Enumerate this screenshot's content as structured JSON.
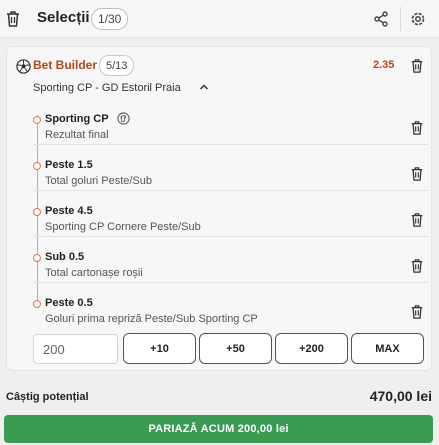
{
  "header": {
    "title": "Selecții",
    "count": "1/30"
  },
  "builder": {
    "label": "Bet Builder",
    "count": "5/13",
    "odds": "2.35",
    "match": "Sporting CP - GD Estoril Praia"
  },
  "selections": [
    {
      "name": "Sporting CP",
      "market": "Rezultat final"
    },
    {
      "name": "Peste 1.5",
      "market": "Total goluri Peste/Sub"
    },
    {
      "name": "Peste 4.5",
      "market": "Sporting CP Cornere Peste/Sub"
    },
    {
      "name": "Sub 0.5",
      "market": "Total cartonașe roșii"
    },
    {
      "name": "Peste 0.5",
      "market": "Goluri prima repriză Peste/Sub Sporting CP"
    }
  ],
  "stake": {
    "value": "200",
    "quick_buttons": [
      "+10",
      "+50",
      "+200",
      "MAX"
    ]
  },
  "footer": {
    "potential_label": "Câștig potențial",
    "potential_value": "470,00 lei",
    "bet_button": "PARIAZĂ ACUM 200,00 lei"
  },
  "colors": {
    "accent_orange": "#c2451d",
    "bet_green": "#3b9b53"
  },
  "icons": [
    "trash-icon",
    "share-icon",
    "gear-icon",
    "soccer-ball-icon",
    "chevron-up-icon",
    "football-shirt-icon"
  ]
}
